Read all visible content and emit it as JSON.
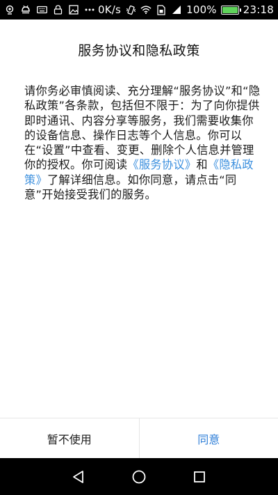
{
  "status_bar": {
    "speed": "0K/s",
    "battery_percent": "100%",
    "battery_level": 1.0,
    "time": "23:18",
    "icons_left": [
      "camera-icon",
      "android-icon",
      "keyboard-icon",
      "lock-icon",
      "image-icon",
      "more-icon"
    ],
    "icons_right": [
      "vibrate-icon",
      "wifi-icon",
      "sim-icon",
      "signal-icon",
      "battery-icon"
    ]
  },
  "dialog": {
    "title": "服务协议和隐私政策",
    "text_part1": "请你务必审慎阅读、充分理解“服务协议”和“隐私政策”各条款，包括但不限于：为了向你提供即时通讯、内容分享等服务，我们需要收集你的设备信息、操作日志等个人信息。你可以在“设置”中查看、变更、删除个人信息并管理你的授权。你可阅读",
    "link_service": "《服务协议》",
    "text_and": "和",
    "link_privacy": "《隐私政策》",
    "text_part2": "了解详细信息。如你同意，请点击“同意”开始接受我们的服务。",
    "decline_label": "暂不使用",
    "agree_label": "同意"
  },
  "colors": {
    "link": "#3b8fde",
    "agree": "#2f7fd8",
    "battery": "#5fd35a"
  }
}
